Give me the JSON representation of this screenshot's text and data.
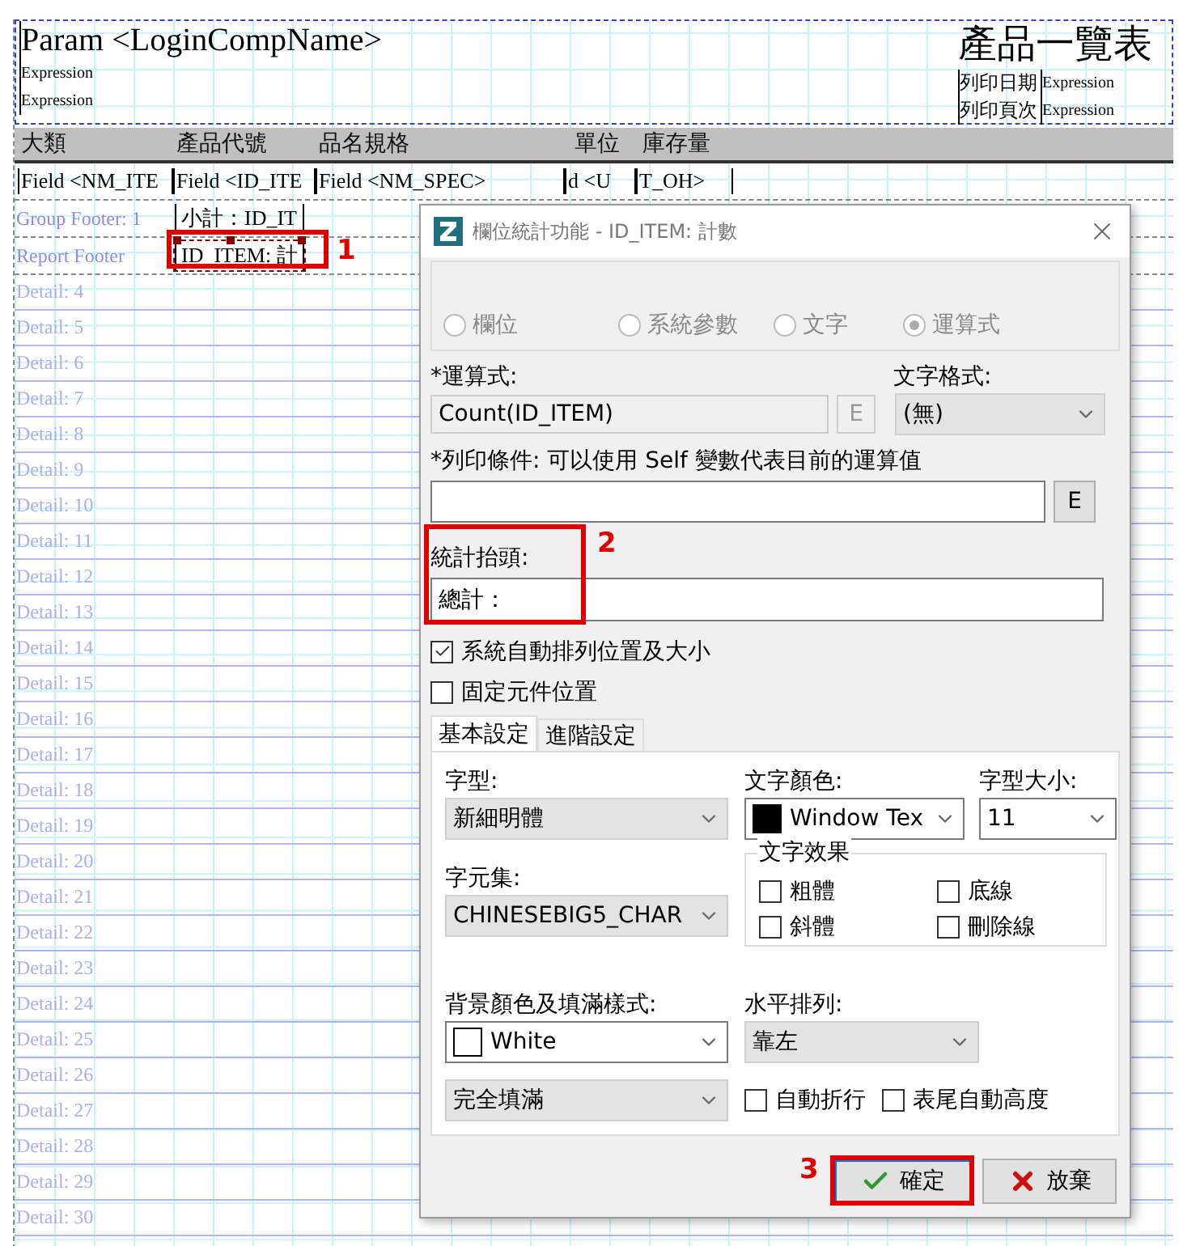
{
  "report": {
    "header": {
      "title": "Param <LoginCompName>",
      "expressions": [
        "Expression",
        "Expression"
      ],
      "report_title": "產品一覽表",
      "info": [
        {
          "label": "列印日期",
          "value": "Expression"
        },
        {
          "label": "列印頁次",
          "value": "Expression"
        }
      ]
    },
    "column_headers": [
      "大類",
      "產品代號",
      "品名規格",
      "單位",
      "庫存量"
    ],
    "detail_fields": [
      "Field <NM_ITE",
      "Field <ID_ITE",
      "Field <NM_SPEC>",
      "d <U",
      "T_OH>"
    ],
    "group_footer": {
      "label": "Group Footer: 1",
      "field": "小計：ID_IT"
    },
    "report_footer": {
      "label": "Report Footer",
      "field": "ID_ITEM: 計",
      "selected": true
    },
    "detail_bands": [
      "Detail: 4",
      "Detail: 5",
      "Detail: 6",
      "Detail: 7",
      "Detail: 8",
      "Detail: 9",
      "Detail: 10",
      "Detail: 11",
      "Detail: 12",
      "Detail: 13",
      "Detail: 14",
      "Detail: 15",
      "Detail: 16",
      "Detail: 17",
      "Detail: 18",
      "Detail: 19",
      "Detail: 20",
      "Detail: 21",
      "Detail: 22",
      "Detail: 23",
      "Detail: 24",
      "Detail: 25",
      "Detail: 26",
      "Detail: 27",
      "Detail: 28",
      "Detail: 29",
      "Detail: 30"
    ]
  },
  "dialog": {
    "title": "欄位統計功能 - ID_ITEM: 計數",
    "source_options": [
      {
        "label": "欄位",
        "selected": false,
        "disabled": true
      },
      {
        "label": "系統參數",
        "selected": false,
        "disabled": true
      },
      {
        "label": "文字",
        "selected": false,
        "disabled": true
      },
      {
        "label": "運算式",
        "selected": true,
        "disabled": true
      }
    ],
    "expression": {
      "label": "*運算式:",
      "value": "Count(ID_ITEM)",
      "button": "E",
      "button_disabled": true
    },
    "text_format": {
      "label": "文字格式:",
      "value": "(無)"
    },
    "print_condition": {
      "label": "*列印條件: 可以使用 Self 變數代表目前的運算值",
      "button": "E",
      "button_disabled": false
    },
    "stat_heading": {
      "label": "統計抬頭:",
      "value": "總計："
    },
    "options": [
      {
        "label": "系統自動排列位置及大小",
        "checked": true
      },
      {
        "label": "固定元件位置",
        "checked": false
      }
    ],
    "tabs": [
      {
        "label": "基本設定",
        "selected": true
      },
      {
        "label": "進階設定",
        "selected": false
      }
    ],
    "font": {
      "label": "字型:",
      "value": "新細明體"
    },
    "text_color": {
      "label": "文字顏色:",
      "value": "Window Tex",
      "color": "#000000"
    },
    "font_size": {
      "label": "字型大小:",
      "value": "11"
    },
    "charset": {
      "label": "字元集:",
      "value": "CHINESEBIG5_CHAR"
    },
    "text_effects": {
      "title": "文字效果",
      "options": [
        {
          "label": "粗體",
          "checked": false
        },
        {
          "label": "底線",
          "checked": false
        },
        {
          "label": "斜體",
          "checked": false
        },
        {
          "label": "刪除線",
          "checked": false
        }
      ]
    },
    "background": {
      "label": "背景顏色及填滿樣式:",
      "value": "White",
      "color": "#ffffff"
    },
    "alignment": {
      "label": "水平排列:",
      "value": "靠左"
    },
    "fill_style": {
      "value": "完全填滿"
    },
    "extra_options": [
      {
        "label": "自動折行",
        "checked": false
      },
      {
        "label": "表尾自動高度",
        "checked": false
      }
    ],
    "buttons": [
      {
        "label": "確定",
        "kind": "ok"
      },
      {
        "label": "放棄",
        "kind": "cancel"
      }
    ]
  },
  "callouts": [
    {
      "text": "1"
    },
    {
      "text": "2"
    },
    {
      "text": "3"
    }
  ]
}
